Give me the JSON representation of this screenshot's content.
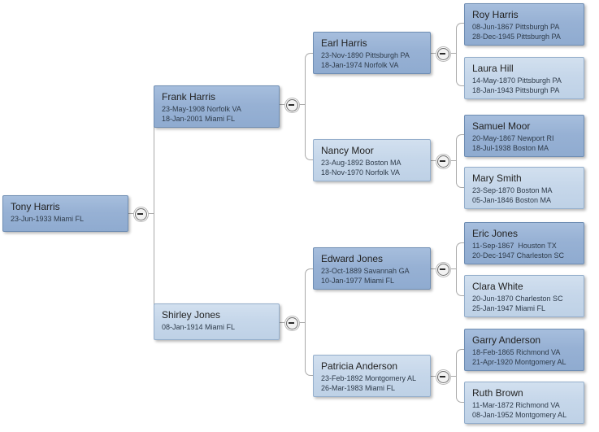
{
  "diagram": {
    "type": "family-tree-pedigree",
    "orientation": "left-to-right",
    "generations": 4,
    "colors": {
      "male_fill": "#97b1d4",
      "female_fill": "#c6d7ea",
      "node_border": "#7f9dc0",
      "connector": "#a9a9a9",
      "background": "#ffffff",
      "name_text": "#232323",
      "detail_text": "#2e3b4a"
    }
  },
  "nodes": {
    "tony_harris": {
      "name": "Tony Harris",
      "line1": "23-Jun-1933 Miami FL",
      "line2": "",
      "sex": "male"
    },
    "frank_harris": {
      "name": "Frank Harris",
      "line1": "23-May-1908 Norfolk VA",
      "line2": "18-Jan-2001 Miami FL",
      "sex": "male"
    },
    "shirley_jones": {
      "name": "Shirley Jones",
      "line1": "08-Jan-1914 Miami FL",
      "line2": "",
      "sex": "female"
    },
    "earl_harris": {
      "name": "Earl Harris",
      "line1": "23-Nov-1890 Pittsburgh PA",
      "line2": "18-Jan-1974 Norfolk VA",
      "sex": "male"
    },
    "nancy_moor": {
      "name": "Nancy Moor",
      "line1": "23-Aug-1892 Boston MA",
      "line2": "18-Nov-1970 Norfolk VA",
      "sex": "female"
    },
    "edward_jones": {
      "name": "Edward Jones",
      "line1": "23-Oct-1889 Savannah GA",
      "line2": "10-Jan-1977 Miami FL",
      "sex": "male"
    },
    "patricia_anderson": {
      "name": "Patricia Anderson",
      "line1": "23-Feb-1892 Montgomery AL",
      "line2": "26-Mar-1983 Miami FL",
      "sex": "female"
    },
    "roy_harris": {
      "name": "Roy Harris",
      "line1": "08-Jun-1867 Pittsburgh PA",
      "line2": "28-Dec-1945 Pittsburgh PA",
      "sex": "male"
    },
    "laura_hill": {
      "name": "Laura Hill",
      "line1": "14-May-1870 Pittsburgh PA",
      "line2": "18-Jan-1943 Pittsburgh PA",
      "sex": "female"
    },
    "samuel_moor": {
      "name": "Samuel Moor",
      "line1": "20-May-1867 Newport RI",
      "line2": "18-Jul-1938 Boston MA",
      "sex": "male"
    },
    "mary_smith": {
      "name": "Mary Smith",
      "line1": "23-Sep-1870 Boston MA",
      "line2": "05-Jan-1846 Boston MA",
      "sex": "female"
    },
    "eric_jones": {
      "name": "Eric Jones",
      "line1": "11-Sep-1867  Houston TX",
      "line2": "20-Dec-1947 Charleston SC",
      "sex": "male"
    },
    "clara_white": {
      "name": "Clara White",
      "line1": "20-Jun-1870 Charleston SC",
      "line2": "25-Jan-1947 Miami FL",
      "sex": "female"
    },
    "garry_anderson": {
      "name": "Garry Anderson",
      "line1": "18-Feb-1865 Richmond VA",
      "line2": "21-Apr-1920 Montgomery AL",
      "sex": "male"
    },
    "ruth_brown": {
      "name": "Ruth Brown",
      "line1": "11-Mar-1872 Richmond VA",
      "line2": "08-Jan-1952 Montgomery AL",
      "sex": "female"
    }
  },
  "toggles": {
    "icon": "minus-circle-icon",
    "state": "expanded",
    "items": [
      "toggle-tony-harris",
      "toggle-frank-harris",
      "toggle-shirley-jones",
      "toggle-earl-harris",
      "toggle-nancy-moor",
      "toggle-edward-jones",
      "toggle-patricia-anderson"
    ]
  }
}
